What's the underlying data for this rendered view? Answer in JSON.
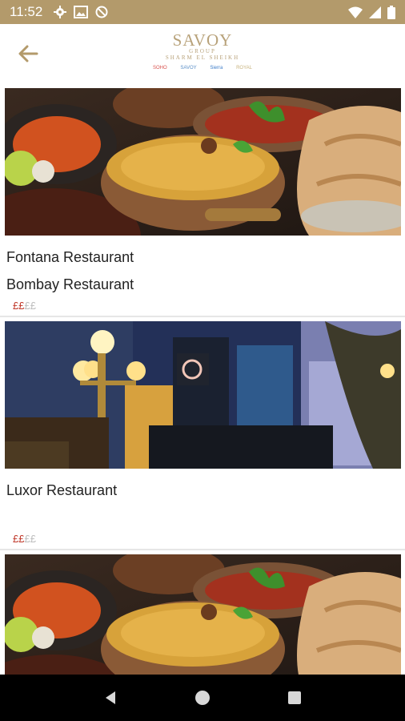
{
  "status_bar": {
    "time": "11:52",
    "left_icons": [
      "gear-icon",
      "image-icon",
      "dnd-icon"
    ],
    "right_icons": [
      "wifi-icon",
      "signal-icon",
      "battery-icon"
    ]
  },
  "header": {
    "logo_main": "SAVOY",
    "logo_group": "GROUP",
    "logo_location": "SHARM EL SHEIKH",
    "brands": [
      "SOHO",
      "SAVOY",
      "Sierra",
      "ROYAL"
    ],
    "back_icon": "back-arrow-icon"
  },
  "restaurants": [
    {
      "names": [
        "Fontana Restaurant",
        "Bombay Restaurant"
      ],
      "price_level": "££££",
      "price_active": "££",
      "price_inactive": "££",
      "image": "indian-food-photo"
    },
    {
      "names": [
        "Luxor Restaurant"
      ],
      "price_level": "££££",
      "price_active": "££",
      "price_inactive": "££",
      "image": "night-street-cafe-photo"
    },
    {
      "names": [],
      "image": "indian-food-photo"
    }
  ],
  "colors": {
    "status_bar": "#b39a6b",
    "accent_gold": "#b8a27a",
    "price_active": "#c0392b",
    "price_inactive": "#bdbdbd",
    "nav_bar": "#000000"
  },
  "nav": {
    "back_icon": "nav-back-icon",
    "home_icon": "nav-home-icon",
    "recents_icon": "nav-recents-icon"
  }
}
